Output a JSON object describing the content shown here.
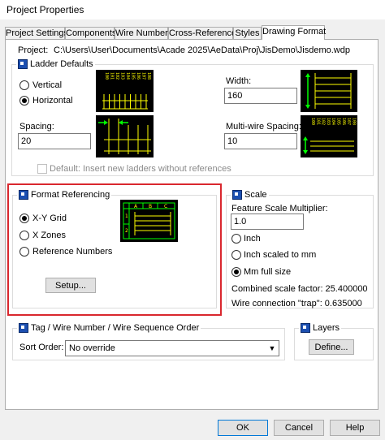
{
  "window": {
    "title": "Project Properties"
  },
  "tabs": [
    {
      "label": "Project Settings"
    },
    {
      "label": "Components"
    },
    {
      "label": "Wire Numbers"
    },
    {
      "label": "Cross-References"
    },
    {
      "label": "Styles"
    },
    {
      "label": "Drawing Format"
    }
  ],
  "project": {
    "label": "Project:",
    "path": "C:\\Users\\User\\Documents\\Acade 2025\\AeData\\Proj\\JisDemo\\Jisdemo.wdp"
  },
  "ladder_defaults": {
    "title": "Ladder Defaults",
    "vertical": "Vertical",
    "horizontal": "Horizontal",
    "width_label": "Width:",
    "width_value": "160",
    "spacing_label": "Spacing:",
    "spacing_value": "20",
    "multiwire_label": "Multi-wire Spacing:",
    "multiwire_value": "10",
    "default_checkbox": "Default: Insert new ladders without references",
    "ladder_numbers": [
      "100",
      "101",
      "102",
      "103",
      "104",
      "105",
      "106",
      "107",
      "108"
    ]
  },
  "format_referencing": {
    "title": "Format Referencing",
    "xy_grid": "X-Y Grid",
    "x_zones": "X Zones",
    "reference_numbers": "Reference Numbers",
    "setup_button": "Setup...",
    "grid_cols": [
      "A",
      "B",
      "C"
    ],
    "grid_rows": [
      "1",
      "2"
    ]
  },
  "scale": {
    "title": "Scale",
    "feature_label": "Feature Scale Multiplier:",
    "feature_value": "1.0",
    "inch": "Inch",
    "inch_mm": "Inch scaled to mm",
    "mm_full": "Mm full size",
    "combined": "Combined scale factor: 25.400000",
    "trap": "Wire connection \"trap\": 0.635000"
  },
  "tag_order": {
    "title": "Tag / Wire Number / Wire Sequence Order",
    "sort_label": "Sort Order:",
    "sort_value": "No override"
  },
  "layers": {
    "title": "Layers",
    "define_button": "Define..."
  },
  "footer": {
    "ok": "OK",
    "cancel": "Cancel",
    "help": "Help"
  },
  "colors": {
    "accent": "#0078d7",
    "highlight": "#d9272e",
    "ladder_line": "#ffff00",
    "arrow": "#00ff00"
  }
}
